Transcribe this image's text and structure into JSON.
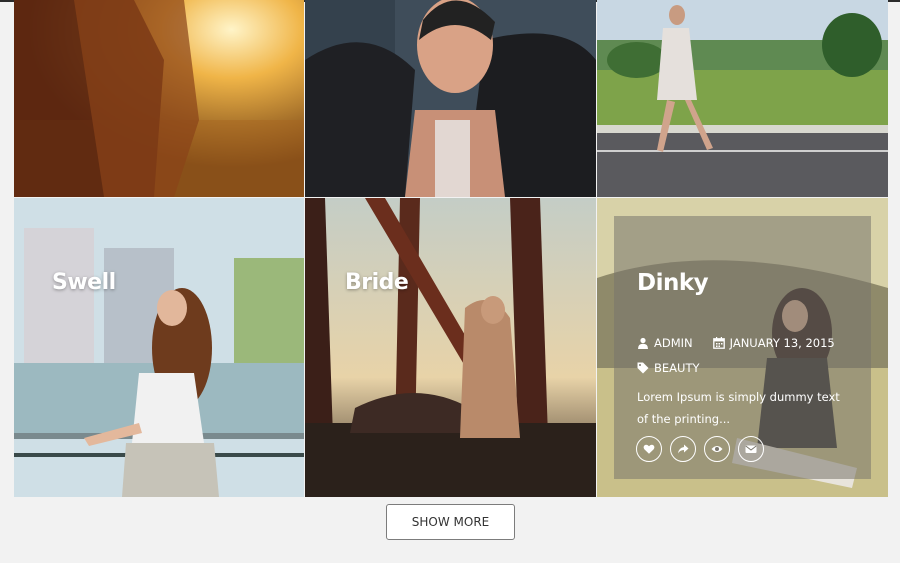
{
  "gallery": {
    "tiles": [
      {
        "name": "warm-field-portrait"
      },
      {
        "name": "fur-coat-portrait"
      },
      {
        "name": "road-walk-photo"
      },
      {
        "title": "Swell"
      },
      {
        "title": "Bride"
      },
      {
        "title": "Dinky",
        "author": "ADMIN",
        "date": "JANUARY 13, 2015",
        "category": "BEAUTY",
        "excerpt": "Lorem Ipsum is simply dummy text of the printing..."
      }
    ]
  },
  "actions": {
    "icons": [
      "heart-icon",
      "share-icon",
      "eye-icon",
      "envelope-icon"
    ]
  },
  "show_more_label": "SHOW MORE"
}
